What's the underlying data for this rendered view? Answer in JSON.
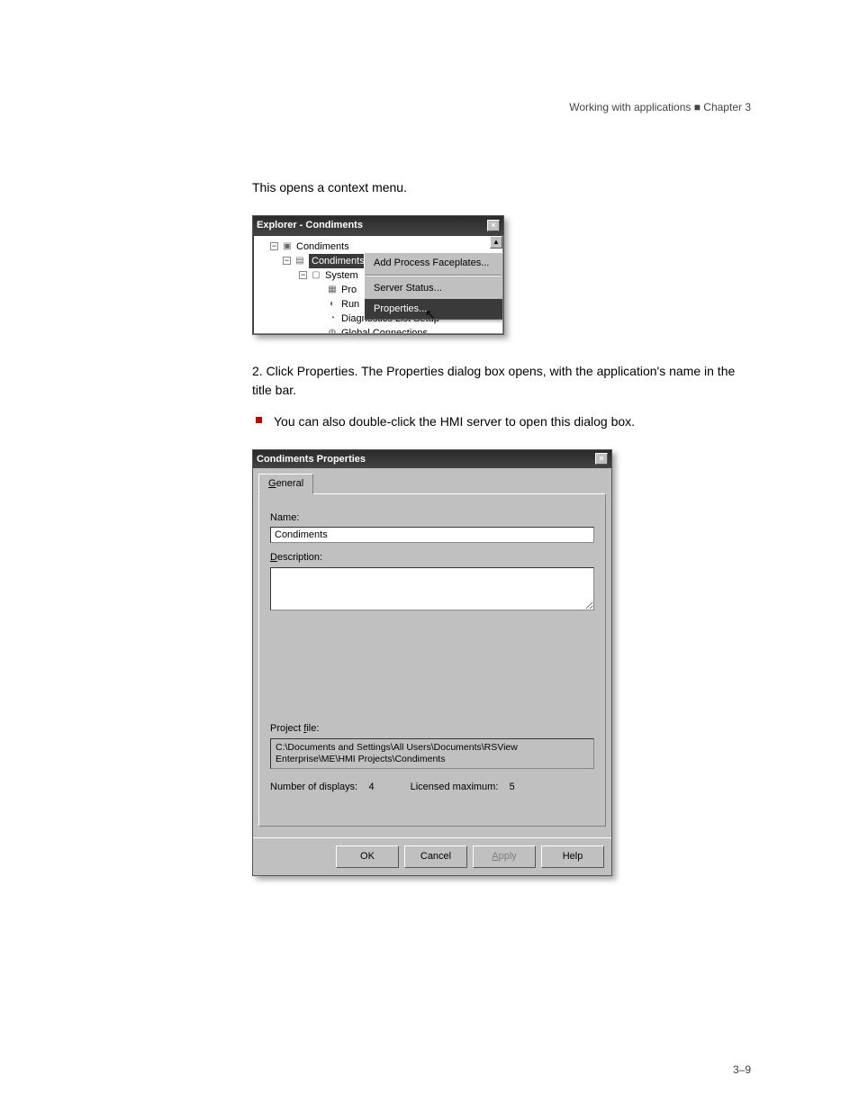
{
  "header": {
    "right": "Working with applications   ■   Chapter 3"
  },
  "text": {
    "lead_in": "This opens a context menu.",
    "step2": "2. Click Properties. The Properties dialog box opens, with the application's name in the title bar.",
    "note": "You can also double-click the HMI server to open this dialog box.",
    "footer_pagenum": "3–9"
  },
  "explorer": {
    "title": "Explorer - Condiments",
    "tree": {
      "root": "Condiments",
      "hmi_server": "Condiments",
      "system_folder": "System",
      "items": {
        "pro": "Pro",
        "run": "Run",
        "diag": "Diagnostics List Setup",
        "global": "Global Connections"
      }
    },
    "menu": {
      "add": "Add Process Faceplates...",
      "status": "Server Status...",
      "props": "Properties..."
    }
  },
  "propdlg": {
    "title": "Condiments Properties",
    "tab": "General",
    "labels": {
      "name": "Name:",
      "desc": "Description:",
      "projfile": "Project file:",
      "displays": "Number of displays:",
      "licensed": "Licensed maximum:"
    },
    "values": {
      "name": "Condiments",
      "projfile": "C:\\Documents and Settings\\All Users\\Documents\\RSView Enterprise\\ME\\HMI Projects\\Condiments",
      "displays": "4",
      "licensed": "5"
    },
    "buttons": {
      "ok": "OK",
      "cancel": "Cancel",
      "apply": "Apply",
      "help": "Help"
    }
  }
}
